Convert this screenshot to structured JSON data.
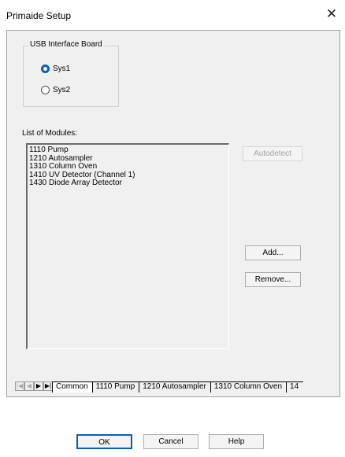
{
  "window": {
    "title": "Primaide Setup",
    "close_glyph": "✕"
  },
  "usb_group": {
    "label": "USB Interface Board",
    "options": [
      {
        "label": "Sys1",
        "selected": true
      },
      {
        "label": "Sys2",
        "selected": false
      }
    ]
  },
  "modules": {
    "label": "List of Modules:",
    "items": [
      "1110 Pump",
      "1210 Autosampler",
      "1310 Column Oven",
      "1410 UV Detector (Channel 1)",
      "1430 Diode Array Detector"
    ]
  },
  "buttons": {
    "autodetect": "Autodetect",
    "add": "Add...",
    "remove": "Remove..."
  },
  "tabs": {
    "nav": [
      "|◀",
      "◀",
      "▶",
      "▶|"
    ],
    "items": [
      "Common",
      "1110 Pump",
      "1210 Autosampler",
      "1310 Column Oven",
      "14"
    ],
    "active": "Common"
  },
  "dialog_buttons": {
    "ok": "OK",
    "cancel": "Cancel",
    "help": "Help"
  }
}
